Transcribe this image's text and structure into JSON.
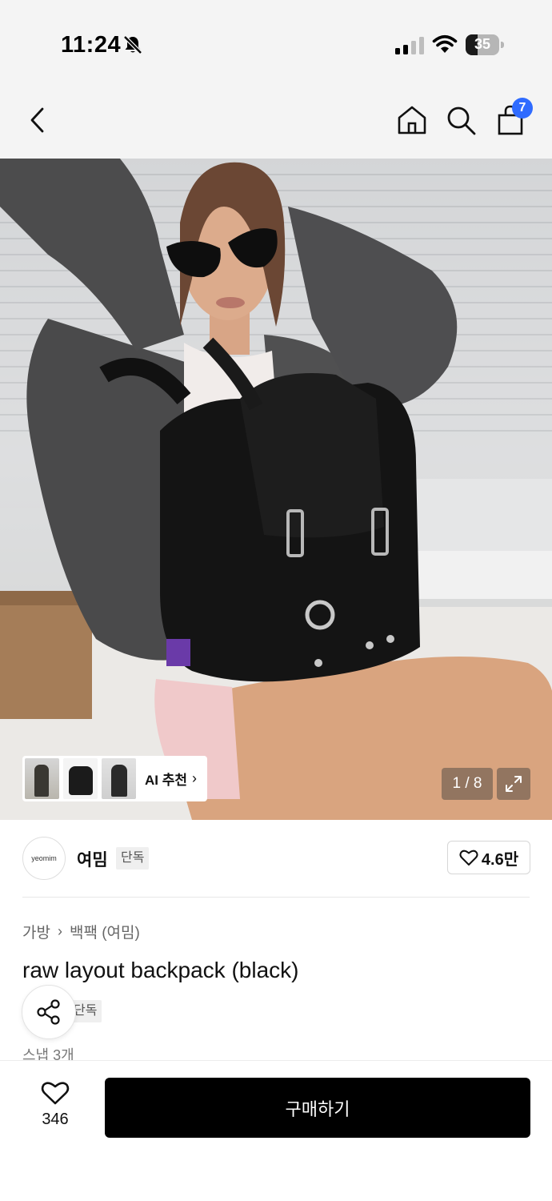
{
  "status_bar": {
    "time": "11:24",
    "battery_level": "35",
    "battery_fraction": 0.35,
    "icons": [
      "bell-slash-icon",
      "signal-icon",
      "wifi-icon",
      "battery-icon"
    ]
  },
  "nav": {
    "back_icon": "chevron-left-icon",
    "home_icon": "home-icon",
    "search_icon": "search-icon",
    "cart_icon": "shopping-bag-icon",
    "cart_count": "7",
    "badge_color": "#2f6bff"
  },
  "gallery": {
    "ai_label": "AI 추천",
    "counter": "1 / 8",
    "expand_icon": "expand-icon"
  },
  "brand": {
    "logo_text": "yeomim",
    "name": "여밈",
    "exclusive_tag": "단독",
    "likes": "4.6만"
  },
  "product": {
    "breadcrumbs": [
      "가방",
      "백팩 (여밈)"
    ],
    "title": "raw layout backpack (black)",
    "exclusive_tag": "단독",
    "snap_count": "스냅 3개"
  },
  "bottom_bar": {
    "wish_count": "346",
    "buy_label": "구매하기",
    "button_color": "#000000"
  }
}
